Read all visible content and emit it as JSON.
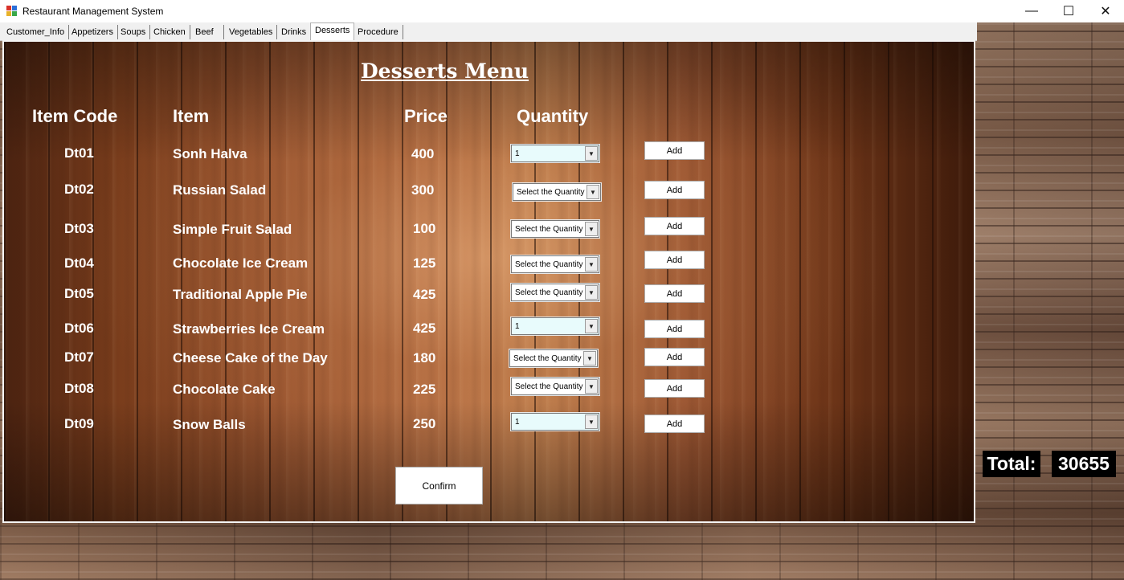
{
  "window": {
    "title": "Restaurant Management System",
    "minimize_glyph": "—",
    "maximize_glyph": "☐",
    "close_glyph": "✕"
  },
  "tabs": [
    {
      "label": "Customer_Info"
    },
    {
      "label": "Appetizers"
    },
    {
      "label": "Soups"
    },
    {
      "label": "Chicken"
    },
    {
      "label": "Beef"
    },
    {
      "label": "Vegetables"
    },
    {
      "label": "Drinks"
    },
    {
      "label": "Desserts",
      "active": true
    },
    {
      "label": "Procedure"
    }
  ],
  "menu": {
    "title": "Desserts Menu",
    "columns": {
      "code": "Item Code",
      "item": "Item",
      "price": "Price",
      "quantity": "Quantity"
    },
    "add_label": "Add",
    "rows": [
      {
        "code": "Dt01",
        "item": "Sonh Halva",
        "price": "400",
        "quantity": "1"
      },
      {
        "code": "Dt02",
        "item": "Russian Salad",
        "price": "300",
        "quantity": "Select the Quantity"
      },
      {
        "code": "Dt03",
        "item": "Simple Fruit Salad",
        "price": "100",
        "quantity": "Select the Quantity"
      },
      {
        "code": "Dt04",
        "item": "Chocolate Ice Cream",
        "price": "125",
        "quantity": "Select the Quantity"
      },
      {
        "code": "Dt05",
        "item": "Traditional Apple Pie",
        "price": "425",
        "quantity": "Select the Quantity"
      },
      {
        "code": "Dt06",
        "item": "Strawberries Ice Cream",
        "price": "425",
        "quantity": "1"
      },
      {
        "code": "Dt07",
        "item": "Cheese Cake of the Day",
        "price": "180",
        "quantity": "Select the Quantity"
      },
      {
        "code": "Dt08",
        "item": "Chocolate Cake",
        "price": "225",
        "quantity": "Select the Quantity"
      },
      {
        "code": "Dt09",
        "item": "Snow Balls",
        "price": "250",
        "quantity": "1"
      }
    ],
    "confirm_label": "Confirm"
  },
  "total": {
    "label": "Total:",
    "value": "30655"
  },
  "colors": {
    "quantity_selected_bg": "#e8fbfc",
    "total_bg": "#000000"
  }
}
